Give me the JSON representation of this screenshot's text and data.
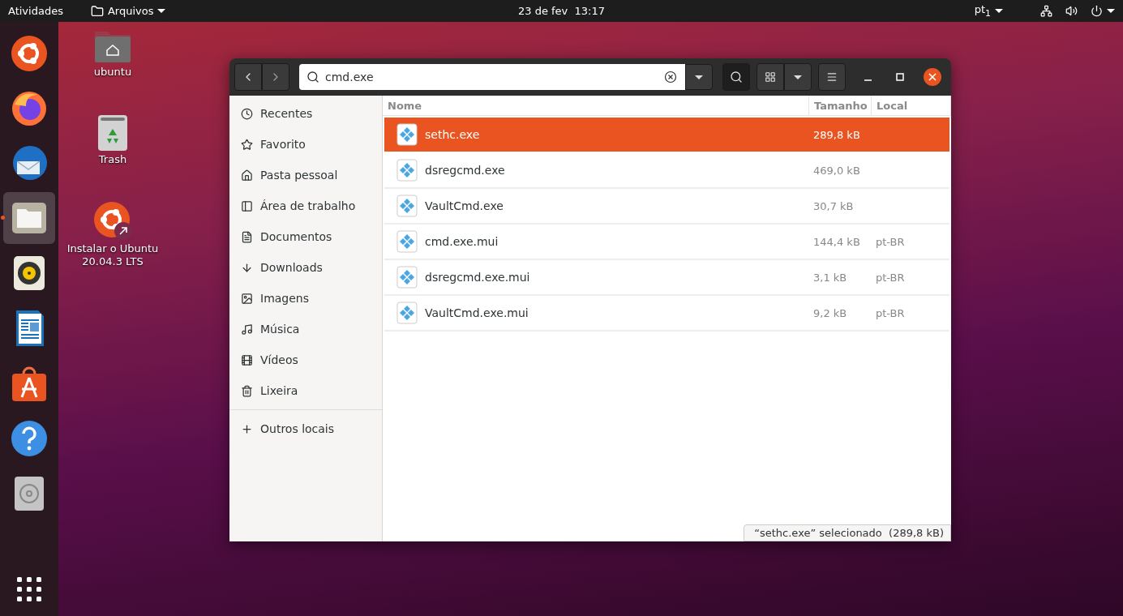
{
  "top_bar": {
    "activities": "Atividades",
    "app_menu": "Arquivos",
    "clock": "23 de fev  13:17",
    "keyboard_layout": "pt$_{1}$"
  },
  "dock": {
    "items": [
      {
        "kind": "ubuntu",
        "active": false
      },
      {
        "kind": "firefox",
        "active": false
      },
      {
        "kind": "mail",
        "active": false
      },
      {
        "kind": "files",
        "active": true
      },
      {
        "kind": "speaker",
        "active": false
      },
      {
        "kind": "writer",
        "active": false
      },
      {
        "kind": "store",
        "active": false
      },
      {
        "kind": "help",
        "active": false
      },
      {
        "kind": "disc",
        "active": false
      }
    ]
  },
  "desktop_icons": [
    {
      "kind": "home",
      "label": "ubuntu"
    },
    {
      "kind": "trash",
      "label": "Trash"
    },
    {
      "kind": "installer",
      "label": "Instalar o Ubuntu\n20.04.3 LTS"
    }
  ],
  "window": {
    "search": {
      "value": "cmd.exe"
    },
    "sidebar": {
      "items": [
        {
          "kind": "recent",
          "label": "Recentes",
          "selected": false
        },
        {
          "kind": "star",
          "label": "Favorito",
          "selected": false
        },
        {
          "kind": "home",
          "label": "Pasta pessoal",
          "selected": false
        },
        {
          "kind": "desktop",
          "label": "Área de trabalho",
          "selected": false
        },
        {
          "kind": "document",
          "label": "Documentos",
          "selected": false
        },
        {
          "kind": "download",
          "label": "Downloads",
          "selected": false
        },
        {
          "kind": "image",
          "label": "Imagens",
          "selected": false
        },
        {
          "kind": "music",
          "label": "Música",
          "selected": false
        },
        {
          "kind": "video",
          "label": "Vídeos",
          "selected": false
        },
        {
          "kind": "trash",
          "label": "Lixeira",
          "selected": false
        },
        {
          "kind": "other",
          "label": "Outros locais",
          "selected": false
        }
      ]
    },
    "table": {
      "columns": [
        "Nome",
        "Tamanho",
        "Local"
      ],
      "rows": [
        {
          "name": "sethc.exe",
          "size": "289,8 kB",
          "location": "",
          "selected": true
        },
        {
          "name": "dsregcmd.exe",
          "size": "469,0 kB",
          "location": "",
          "selected": false
        },
        {
          "name": "VaultCmd.exe",
          "size": "30,7 kB",
          "location": "",
          "selected": false
        },
        {
          "name": "cmd.exe.mui",
          "size": "144,4 kB",
          "location": "pt-BR",
          "selected": false
        },
        {
          "name": "dsregcmd.exe.mui",
          "size": "3,1 kB",
          "location": "pt-BR",
          "selected": false
        },
        {
          "name": "VaultCmd.exe.mui",
          "size": "9,2 kB",
          "location": "pt-BR",
          "selected": false
        }
      ]
    },
    "status": "“sethc.exe” selecionado  (289,8 kB)"
  }
}
